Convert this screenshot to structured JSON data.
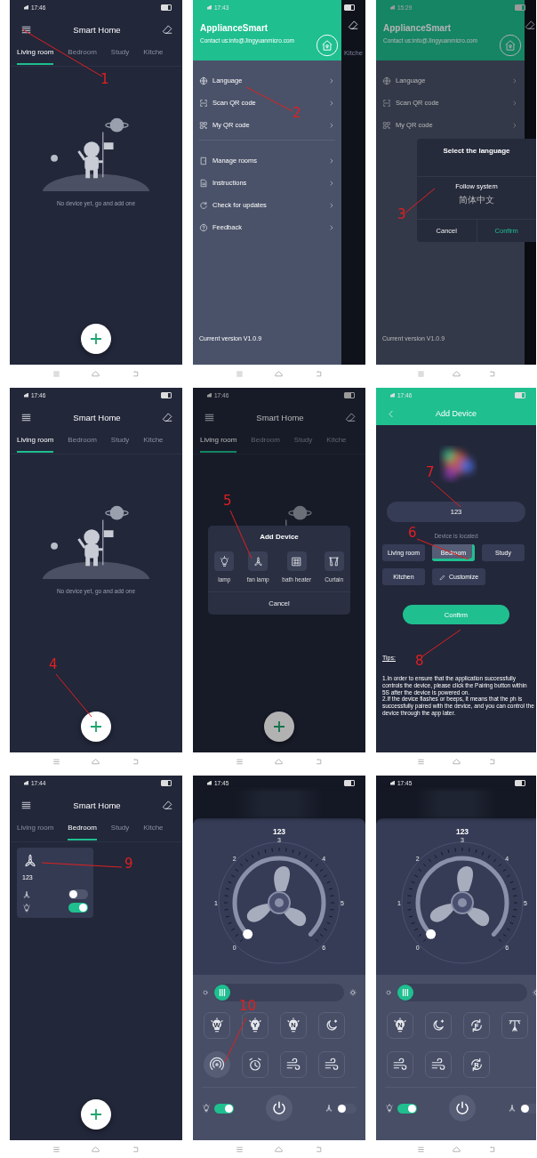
{
  "panels": [
    {
      "kind": "home",
      "status_time": "17:46",
      "title": "Smart Home",
      "tabs": [
        {
          "label": "Living room",
          "selected": true
        },
        {
          "label": "Bedroom",
          "selected": false
        },
        {
          "label": "Study",
          "selected": false
        },
        {
          "label": "Kitche",
          "selected": false
        }
      ],
      "empty_text": "No device yet, go and add one",
      "callouts": [
        "1"
      ]
    },
    {
      "kind": "drawer",
      "status_time": "17:43",
      "app_name": "ApplianceSmart",
      "contact": "Contact us:info@Jingyuanmicro.com",
      "groups": [
        [
          {
            "label": "Language"
          },
          {
            "label": "Scan QR code"
          },
          {
            "label": "My QR code"
          }
        ],
        [
          {
            "label": "Manage rooms"
          },
          {
            "label": "Instructions"
          },
          {
            "label": "Check for updates"
          },
          {
            "label": "Feedback"
          }
        ]
      ],
      "version": "Current version V1.0.9",
      "behind_tab": "Kitche",
      "callouts": [
        "2"
      ]
    },
    {
      "kind": "drawer",
      "status_time": "15:29",
      "app_name": "ApplianceSmart",
      "contact": "Contact us:info@Jingyuanmicro.com",
      "groups": [
        [
          {
            "label": "Language"
          },
          {
            "label": "Scan QR code"
          },
          {
            "label": "My QR code"
          }
        ]
      ],
      "version": "Current version V1.0.9",
      "dialog": {
        "title": "Select the language",
        "options": [
          "Follow system",
          "简体中文"
        ],
        "cancel": "Cancel",
        "confirm": "Confirm"
      },
      "callouts": [
        "3"
      ]
    },
    {
      "kind": "home",
      "status_time": "17:46",
      "title": "Smart Home",
      "tabs": [
        {
          "label": "Living room",
          "selected": true
        },
        {
          "label": "Bedroom",
          "selected": false
        },
        {
          "label": "Study",
          "selected": false
        },
        {
          "label": "Kitche",
          "selected": false
        }
      ],
      "empty_text": "No device yet, go and add one",
      "callouts": [
        "4"
      ]
    },
    {
      "kind": "home",
      "status_time": "17:46",
      "title": "Smart Home",
      "tabs": [
        {
          "label": "Living room",
          "selected": true
        },
        {
          "label": "Bedroom",
          "selected": false
        },
        {
          "label": "Study",
          "selected": false
        },
        {
          "label": "Kitche",
          "selected": false
        }
      ],
      "sheet": {
        "title": "Add Device",
        "options": [
          {
            "kind": "bulb",
            "label": "lamp"
          },
          {
            "kind": "fan",
            "label": "fan lamp"
          },
          {
            "kind": "heater",
            "label": "bath heater"
          },
          {
            "kind": "curtain",
            "label": "Curtain"
          }
        ],
        "cancel": "Cancel"
      },
      "callouts": [
        "5"
      ]
    },
    {
      "kind": "add_form",
      "status_time": "17:46",
      "title": "Add Device",
      "name_value": "123",
      "location_label": "Device is located",
      "rooms": [
        {
          "label": "Living room",
          "selected": false
        },
        {
          "label": "Bedroom",
          "selected": true
        },
        {
          "label": "Study",
          "selected": false
        },
        {
          "label": "Kitchen",
          "selected": false
        }
      ],
      "customize": "Customize",
      "confirm": "Confirm",
      "tips_title": "Tips:",
      "tips": [
        "1.In order to ensure that the application successfully controls the device, please click the Pairing button within 5S after the device is powered on.",
        "2.If the device flashes or beeps, it means that the ph is successfully paired with the device, and you can control the device through the app later."
      ],
      "callouts": [
        "7",
        "6",
        "8"
      ]
    },
    {
      "kind": "home",
      "status_time": "17:44",
      "title": "Smart Home",
      "tabs": [
        {
          "label": "Living room",
          "selected": false
        },
        {
          "label": "Bedroom",
          "selected": true
        },
        {
          "label": "Study",
          "selected": false
        },
        {
          "label": "Kitche",
          "selected": false
        }
      ],
      "devices": [
        {
          "name": "123",
          "fan_on": false,
          "light_on": true
        }
      ],
      "callouts": [
        "9"
      ]
    },
    {
      "kind": "fan_control",
      "status_time": "17:45",
      "device_name": "123",
      "dial": {
        "labels": [
          "0",
          "1",
          "2",
          "3",
          "4",
          "5",
          "6"
        ]
      },
      "brightness": {
        "level": 0
      },
      "buttons": [
        {
          "kind": "bulb",
          "letter": "W",
          "selected": false
        },
        {
          "kind": "bulb",
          "letter": "Y",
          "selected": false
        },
        {
          "kind": "bulb",
          "letter": "N",
          "selected": false
        },
        {
          "kind": "moon",
          "selected": false
        },
        {
          "kind": "signal",
          "selected": true
        },
        {
          "kind": "alarm",
          "selected": false
        },
        {
          "kind": "wind",
          "selected": false
        },
        {
          "kind": "wind",
          "selected": false
        }
      ],
      "light_on": true,
      "fan_on": false,
      "callouts": [
        "10"
      ]
    },
    {
      "kind": "fan_control",
      "status_time": "17:45",
      "device_name": "123",
      "dial": {
        "labels": [
          "0",
          "1",
          "2",
          "3",
          "4",
          "5",
          "6"
        ]
      },
      "brightness": {
        "level": 0
      },
      "buttons": [
        {
          "kind": "bulb",
          "letter": "N",
          "selected": false
        },
        {
          "kind": "moon",
          "selected": false
        },
        {
          "kind": "cycle",
          "letter": "F",
          "selected": false
        },
        {
          "kind": "antenna",
          "selected": false
        },
        {
          "kind": "wind",
          "selected": false
        },
        {
          "kind": "wind",
          "selected": false
        },
        {
          "kind": "cycle",
          "letter": "R",
          "selected": false
        }
      ],
      "light_on": true,
      "fan_on": false
    }
  ]
}
